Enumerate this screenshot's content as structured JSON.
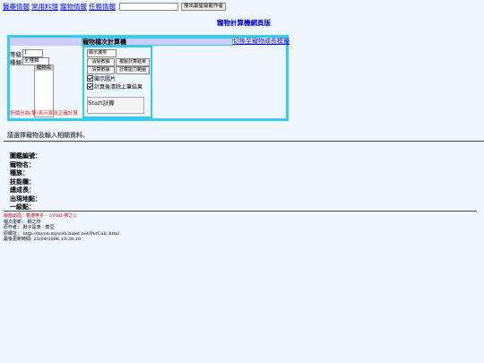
{
  "nav": {
    "links": [
      "醫藥情報",
      "常用料理",
      "寵物情報",
      "任務情報"
    ],
    "search_button": "搜出最星級寵作者"
  },
  "page_title": "寵物計算機網頁版",
  "calculator": {
    "title": "寵物檔次計算機",
    "growth_link": "切換至寵物成長模擬",
    "level_label": "等級",
    "level_value": "1",
    "type_label": "種類:",
    "type_value": "全種類",
    "name_header": "寵物名",
    "red_link": "折價分為(第)表示算法正確計算",
    "display_select": "顯示攜帶",
    "buttons": {
      "clear": "清除數據",
      "recalc": "複製計算結果",
      "reset": "清算數據",
      "range": "計算能力範圍"
    },
    "show_image_label": "顯示圖片",
    "clear_after_label": "計算後清除上筆結果",
    "image_alt": "Start計算"
  },
  "instruction": "請選擇寵物及輸入相關資料。",
  "info_labels": [
    "圖鑑編號：",
    "寵物名：",
    "種族：",
    "技能欄：",
    "總成長：",
    "出現地點：",
    "一級點："
  ],
  "footer": {
    "line1_prefix": "版面出血：",
    "line1_red": "香港幣子 - ☆PBB-帶之☆",
    "line2": "檔次更新： 師之作",
    "line3": "原作者： 默子是表 - 蕉豆",
    "line4": "原網址： http://myon.myweb.hinet.net/PetCalc.html",
    "line5": "最後更新時間: 25/04/2006 10:38:16"
  }
}
